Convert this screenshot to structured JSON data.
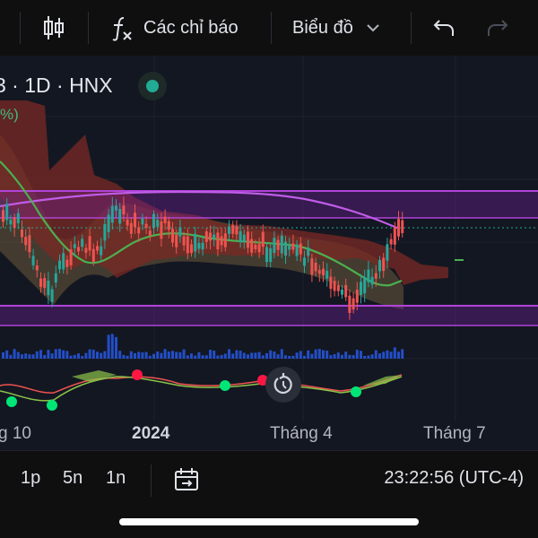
{
  "toolbar": {
    "indicators_label": "Các chỉ báo",
    "chart_type_label": "Biểu đồ",
    "icons": [
      "candlestick-icon",
      "function-icon",
      "chevron-down-icon",
      "undo-icon",
      "redo-icon"
    ]
  },
  "legend": {
    "symbol_text": "3 · 1D · HNX",
    "percent_text": "%)"
  },
  "time_axis": {
    "labels": [
      "g 10",
      "2024",
      "Tháng 4",
      "Tháng 7"
    ]
  },
  "bottom_bar": {
    "intervals": [
      "1p",
      "5n",
      "1n"
    ],
    "clock": "23:22:56 (UTC-4)",
    "icons": [
      "date-range-icon"
    ]
  },
  "colors": {
    "up": "#26a69a",
    "down": "#ef5350",
    "ma_green": "#4caf50",
    "ma_purple": "#b043d8",
    "cloud_red": "#7a2a24",
    "cloud_tan": "#6b5a3a",
    "volume": "#2962ff"
  }
}
